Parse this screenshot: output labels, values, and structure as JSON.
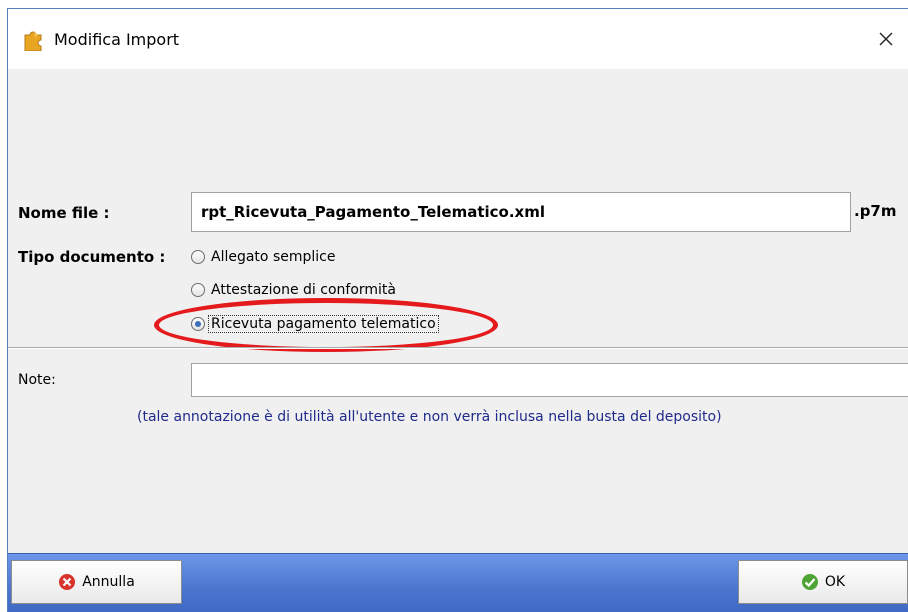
{
  "window": {
    "title": "Modifica Import",
    "app_icon": "puzzle-icon",
    "close_icon": "close-icon"
  },
  "form": {
    "filename_label": "Nome file :",
    "filename_value": "rpt_Ricevuta_Pagamento_Telematico.xml",
    "extension": ".p7m",
    "doc_type_label": "Tipo documento :",
    "doc_type_options": [
      {
        "label": "Allegato semplice",
        "selected": false
      },
      {
        "label": "Attestazione di conformità",
        "selected": false
      },
      {
        "label": "Ricevuta pagamento telematico",
        "selected": true
      }
    ],
    "note_label": "Note:",
    "note_value": "",
    "note_hint": "(tale annotazione è di utilità all'utente e non verrà inclusa nella busta del deposito)"
  },
  "footer": {
    "cancel_label": "Annulla",
    "cancel_icon": "cancel-x-icon",
    "ok_label": "OK",
    "ok_icon": "check-icon"
  },
  "colors": {
    "highlight": "#e41a1c",
    "hint_text": "#1f2b8a",
    "footer_bar": "#4b76cf"
  }
}
